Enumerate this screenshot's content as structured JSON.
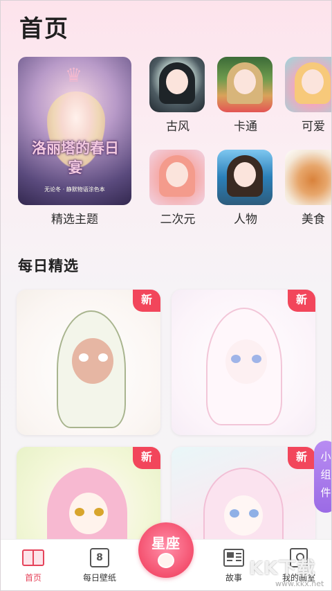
{
  "header": {
    "title": "首页"
  },
  "featured": {
    "label": "精选主题",
    "artwork_title": "洛丽塔的春日宴",
    "artwork_subtitle": "无论冬 · 静默物语涂色本"
  },
  "categories": [
    {
      "label": "古风",
      "icon": "gufeng-thumb"
    },
    {
      "label": "卡通",
      "icon": "katong-thumb"
    },
    {
      "label": "可爱",
      "icon": "keai-thumb"
    },
    {
      "label": "二次元",
      "icon": "erciyuan-thumb"
    },
    {
      "label": "人物",
      "icon": "renwu-thumb"
    },
    {
      "label": "美食",
      "icon": "meishi-thumb"
    }
  ],
  "daily": {
    "title": "每日精选",
    "cards": [
      {
        "badge": "新"
      },
      {
        "badge": "新"
      },
      {
        "badge": "新"
      },
      {
        "badge": "新"
      }
    ]
  },
  "widget": {
    "label": "小组件"
  },
  "tabbar": {
    "items": [
      {
        "label": "首页",
        "icon": "book-icon",
        "active": true
      },
      {
        "label": "每日壁纸",
        "icon": "calendar-icon",
        "day": "8"
      },
      {
        "label": "故事",
        "icon": "newspaper-icon"
      },
      {
        "label": "我的画室",
        "icon": "frame-icon"
      }
    ],
    "center": {
      "label": "星座"
    }
  },
  "watermark": {
    "text": "KK下载",
    "url": "www.kkx.net"
  },
  "colors": {
    "accent": "#e5435a",
    "badge": "#f2465b",
    "widget": "#9b6be5"
  }
}
